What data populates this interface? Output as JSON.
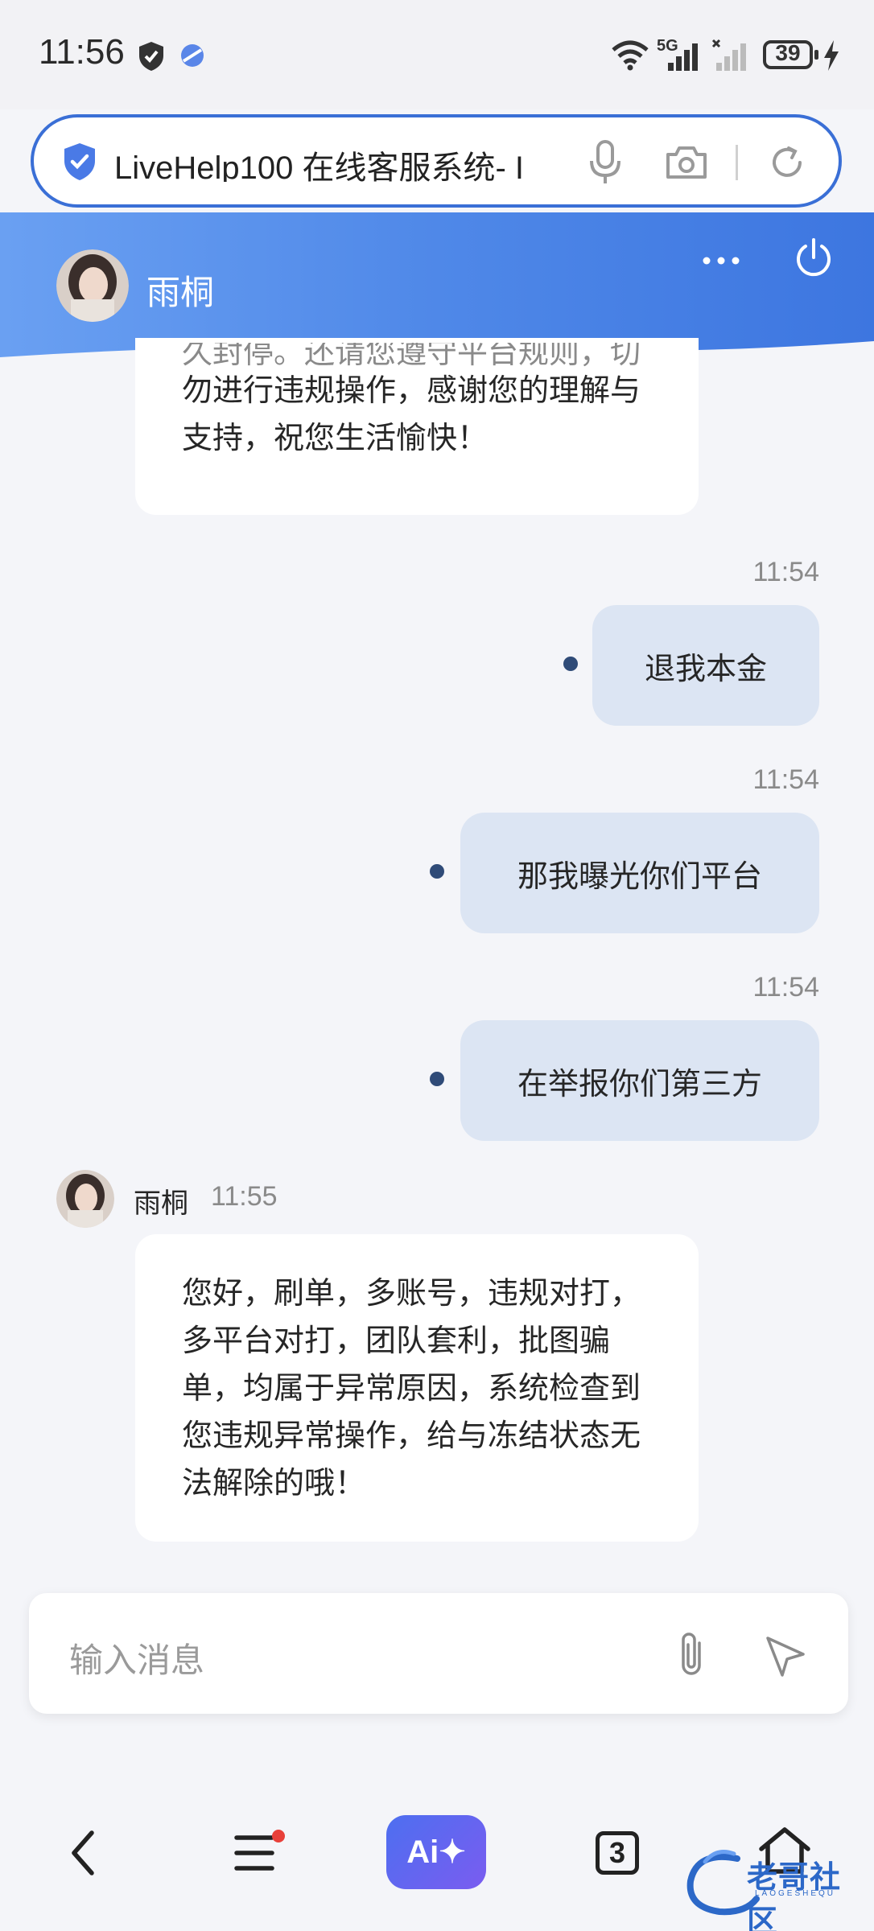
{
  "status_bar": {
    "time": "11:56",
    "network": "5G",
    "battery": "39",
    "icons": [
      "shield-icon",
      "vpn-icon",
      "wifi-icon",
      "signal-icon",
      "signal-empty-icon",
      "battery-icon",
      "charging-icon"
    ]
  },
  "browser": {
    "url_text": "LiveHelp100 在线客服系统- I",
    "icons": [
      "secure-shield-icon",
      "microphone-icon",
      "camera-icon",
      "refresh-icon"
    ]
  },
  "chat_header": {
    "agent_name": "雨桐",
    "icons": [
      "more-icon",
      "power-icon"
    ]
  },
  "messages": [
    {
      "side": "left",
      "lines": [
        "久封停。还请您遵守平台规则，切",
        "勿进行违规操作，感谢您的理解与",
        "支持，祝您生活愉快！"
      ]
    },
    {
      "side": "right",
      "time": "11:54",
      "text": "退我本金"
    },
    {
      "side": "right",
      "time": "11:54",
      "text": "那我曝光你们平台"
    },
    {
      "side": "right",
      "time": "11:54",
      "text": "在举报你们第三方"
    },
    {
      "side": "left",
      "sender": "雨桐",
      "time": "11:55",
      "lines": [
        "您好，刷单，多账号，违规对打，",
        "多平台对打，团队套利，批图骗",
        "单，均属于异常原因，系统检查到",
        "您违规异常操作，给与冻结状态无",
        "法解除的哦！"
      ]
    }
  ],
  "composer": {
    "placeholder": "输入消息",
    "icons": [
      "attachment-icon",
      "send-icon"
    ]
  },
  "bottom_nav": {
    "ai_label": "Ai✦",
    "tab_count": "3",
    "icons": [
      "back-icon",
      "menu-icon",
      "home-icon"
    ],
    "watermark_text": "老哥社区",
    "watermark_sub": "LAOGESHEQU"
  },
  "colors": {
    "header_gradient_start": "#6aa0f2",
    "header_gradient_end": "#3d76e0",
    "sent_bubble": "#dce5f3",
    "url_border": "#3a6fd6",
    "ai_button": "#5b66f0"
  }
}
